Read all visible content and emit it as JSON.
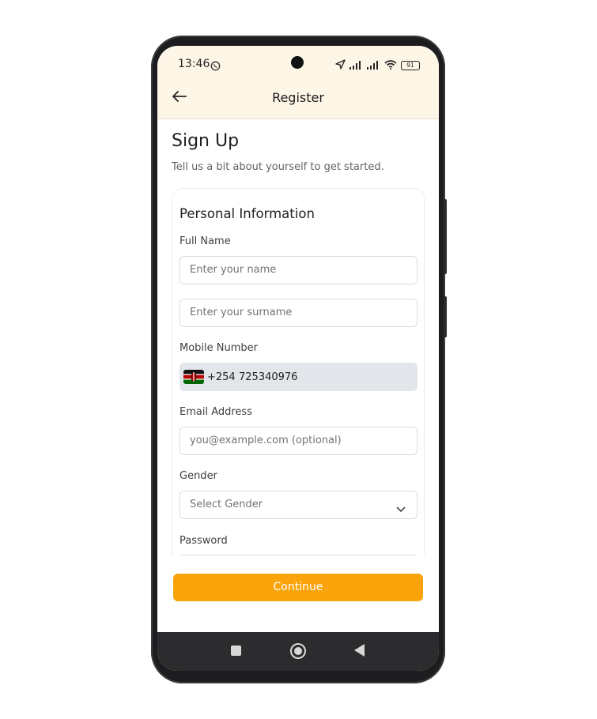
{
  "status_bar": {
    "time": "13:46",
    "battery": "91"
  },
  "header": {
    "title": "Register"
  },
  "page": {
    "heading": "Sign Up",
    "subheading": "Tell us a bit about yourself to get started."
  },
  "form": {
    "section_title": "Personal Information",
    "full_name_label": "Full Name",
    "name_placeholder": "Enter your name",
    "surname_placeholder": "Enter your surname",
    "mobile_label": "Mobile Number",
    "country_code": "+254",
    "mobile_value": "725340976",
    "email_label": "Email Address",
    "email_placeholder": "you@example.com (optional)",
    "gender_label": "Gender",
    "gender_value": "Select Gender",
    "password_label": "Password"
  },
  "actions": {
    "continue_label": "Continue"
  },
  "colors": {
    "accent": "#fba30b",
    "header_bg": "#fdf6e7",
    "phone_field_bg": "#e2e5ea"
  },
  "icons": [
    "whatsapp-icon",
    "location-icon",
    "signal-icon",
    "wifi-icon",
    "battery-icon",
    "back-arrow-icon",
    "chevron-down-icon",
    "kenya-flag-icon",
    "nav-recents-icon",
    "nav-home-icon",
    "nav-back-icon"
  ]
}
